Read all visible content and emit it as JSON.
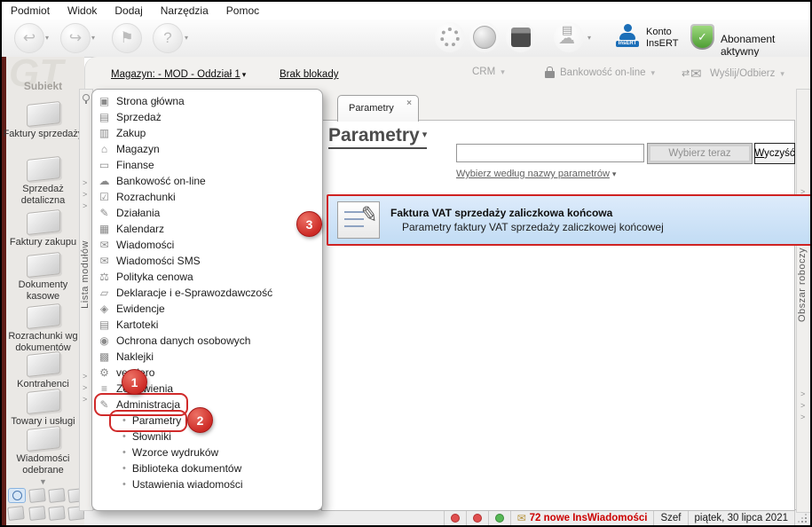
{
  "menu": {
    "items": [
      "Podmiot",
      "Widok",
      "Dodaj",
      "Narzędzia",
      "Pomoc"
    ]
  },
  "toolbar": {
    "konto_line1": "Konto",
    "konto_line2": "InsERT",
    "insert_badge": "InsERT",
    "abonament": "Abonament aktywny"
  },
  "subtoolbar": {
    "magazyn": "Magazyn: - MOD - Oddział 1",
    "blokada": "Brak blokady",
    "crm": "CRM",
    "bankowosc": "Bankowość on-line",
    "wyslij": "Wyślij/Odbierz"
  },
  "sidebar": {
    "watermark": "GT",
    "logo": "Subiekt",
    "modules": [
      {
        "label": "Faktury sprzedaży"
      },
      {
        "label": "Sprzedaż detaliczna"
      },
      {
        "label": "Faktury zakupu"
      },
      {
        "label": "Dokumenty kasowe"
      },
      {
        "label": "Rozrachunki wg dokumentów"
      },
      {
        "label": "Kontrahenci"
      },
      {
        "label": "Towary i usługi"
      },
      {
        "label": "Wiadomości odebrane"
      }
    ]
  },
  "strips": {
    "left": "Lista modułów",
    "right": "Obszar roboczy"
  },
  "tree": {
    "items": [
      {
        "label": "Strona główna",
        "glyph": "▣"
      },
      {
        "label": "Sprzedaż",
        "glyph": "▤"
      },
      {
        "label": "Zakup",
        "glyph": "▥"
      },
      {
        "label": "Magazyn",
        "glyph": "⌂"
      },
      {
        "label": "Finanse",
        "glyph": "▭"
      },
      {
        "label": "Bankowość on-line",
        "glyph": "☁"
      },
      {
        "label": "Rozrachunki",
        "glyph": "☑"
      },
      {
        "label": "Działania",
        "glyph": "✎"
      },
      {
        "label": "Kalendarz",
        "glyph": "▦"
      },
      {
        "label": "Wiadomości",
        "glyph": "✉"
      },
      {
        "label": "Wiadomości SMS",
        "glyph": "✉"
      },
      {
        "label": "Polityka cenowa",
        "glyph": "⚖"
      },
      {
        "label": "Deklaracje i e-Sprawozdawczość",
        "glyph": "▱"
      },
      {
        "label": "Ewidencje",
        "glyph": "◈"
      },
      {
        "label": "Kartoteki",
        "glyph": "▤"
      },
      {
        "label": "Ochrona danych osobowych",
        "glyph": "◉"
      },
      {
        "label": "Naklejki",
        "glyph": "▩"
      },
      {
        "label": "vendero",
        "glyph": "⚙"
      },
      {
        "label": "Zestawienia",
        "glyph": "≡"
      },
      {
        "label": "Administracja",
        "glyph": "✎"
      }
    ],
    "children": [
      {
        "label": "Parametry"
      },
      {
        "label": "Słowniki"
      },
      {
        "label": "Wzorce wydruków"
      },
      {
        "label": "Biblioteka dokumentów"
      },
      {
        "label": "Ustawienia wiadomości"
      }
    ]
  },
  "main": {
    "tab": "Parametry",
    "title": "Parametry",
    "search_value": "",
    "select_btn": "Wybierz teraz",
    "clear_prefix": "W",
    "clear_rest": "yczyść",
    "filter_link": "Wybierz według nazwy parametrów",
    "result": {
      "title": "Faktura VAT sprzedaży zaliczkowa końcowa",
      "subtitle": "Parametry faktury VAT sprzedaży zaliczkowej końcowej"
    }
  },
  "statusbar": {
    "messages": "72 nowe InsWiadomości",
    "user": "Szef",
    "date": "piątek, 30 lipca 2021"
  },
  "annotations": {
    "step1": "1",
    "step2": "2",
    "step3": "3"
  },
  "colors": {
    "annotation_red": "#d02a2a",
    "selection_blue": "#c9e0f6",
    "status_red": "#cc0000",
    "shield_green": "#4e9d34",
    "insert_blue": "#1c6fb8",
    "sidebar_stripe": "#5f1d18"
  }
}
